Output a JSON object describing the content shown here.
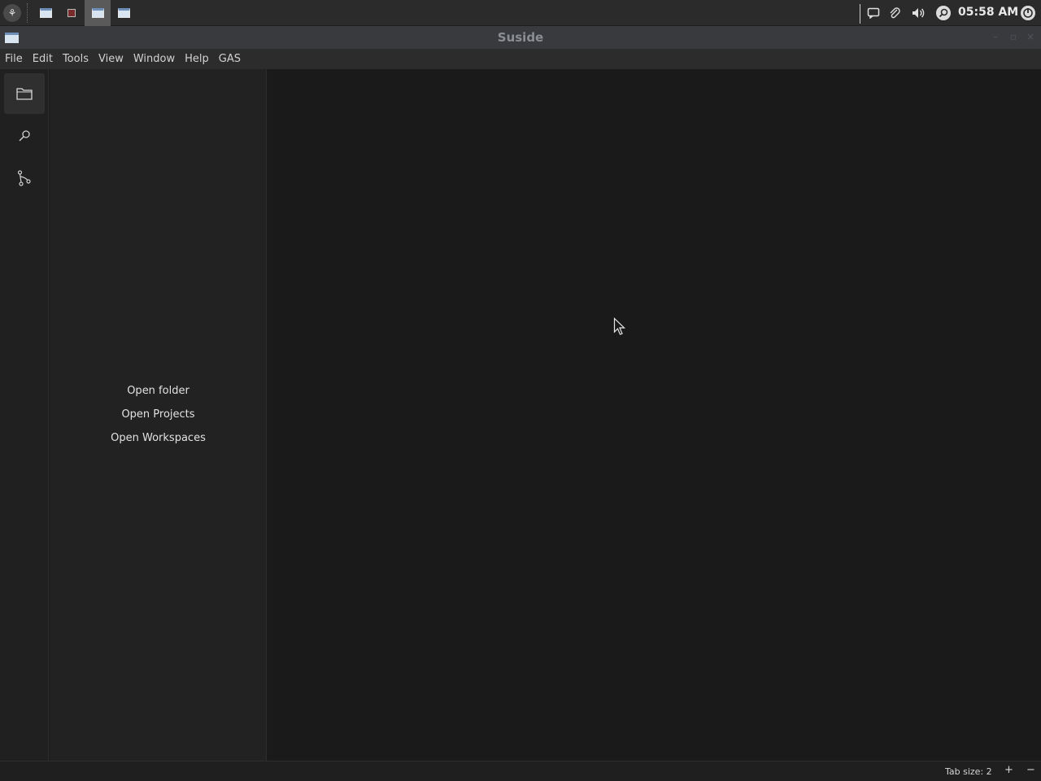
{
  "taskbar": {
    "clock": "05:58 AM",
    "tasks": [
      "window-1",
      "window-2",
      "window-3",
      "window-4"
    ]
  },
  "window": {
    "title": "Suside"
  },
  "menubar": {
    "items": [
      "File",
      "Edit",
      "Tools",
      "View",
      "Window",
      "Help",
      "GAS"
    ]
  },
  "activitybar": {
    "items": [
      "folder-icon",
      "search-icon",
      "source-control-icon"
    ]
  },
  "sidebar": {
    "open_folder": "Open folder",
    "open_projects": "Open Projects",
    "open_workspaces": "Open Workspaces"
  },
  "statusbar": {
    "tab_size": "Tab size: 2",
    "increase": "+",
    "decrease": "−"
  },
  "colors": {
    "background": "#1a1a1a",
    "sidebar": "#222222",
    "activitybar": "#202020",
    "taskbar": "#2b2b2b"
  }
}
